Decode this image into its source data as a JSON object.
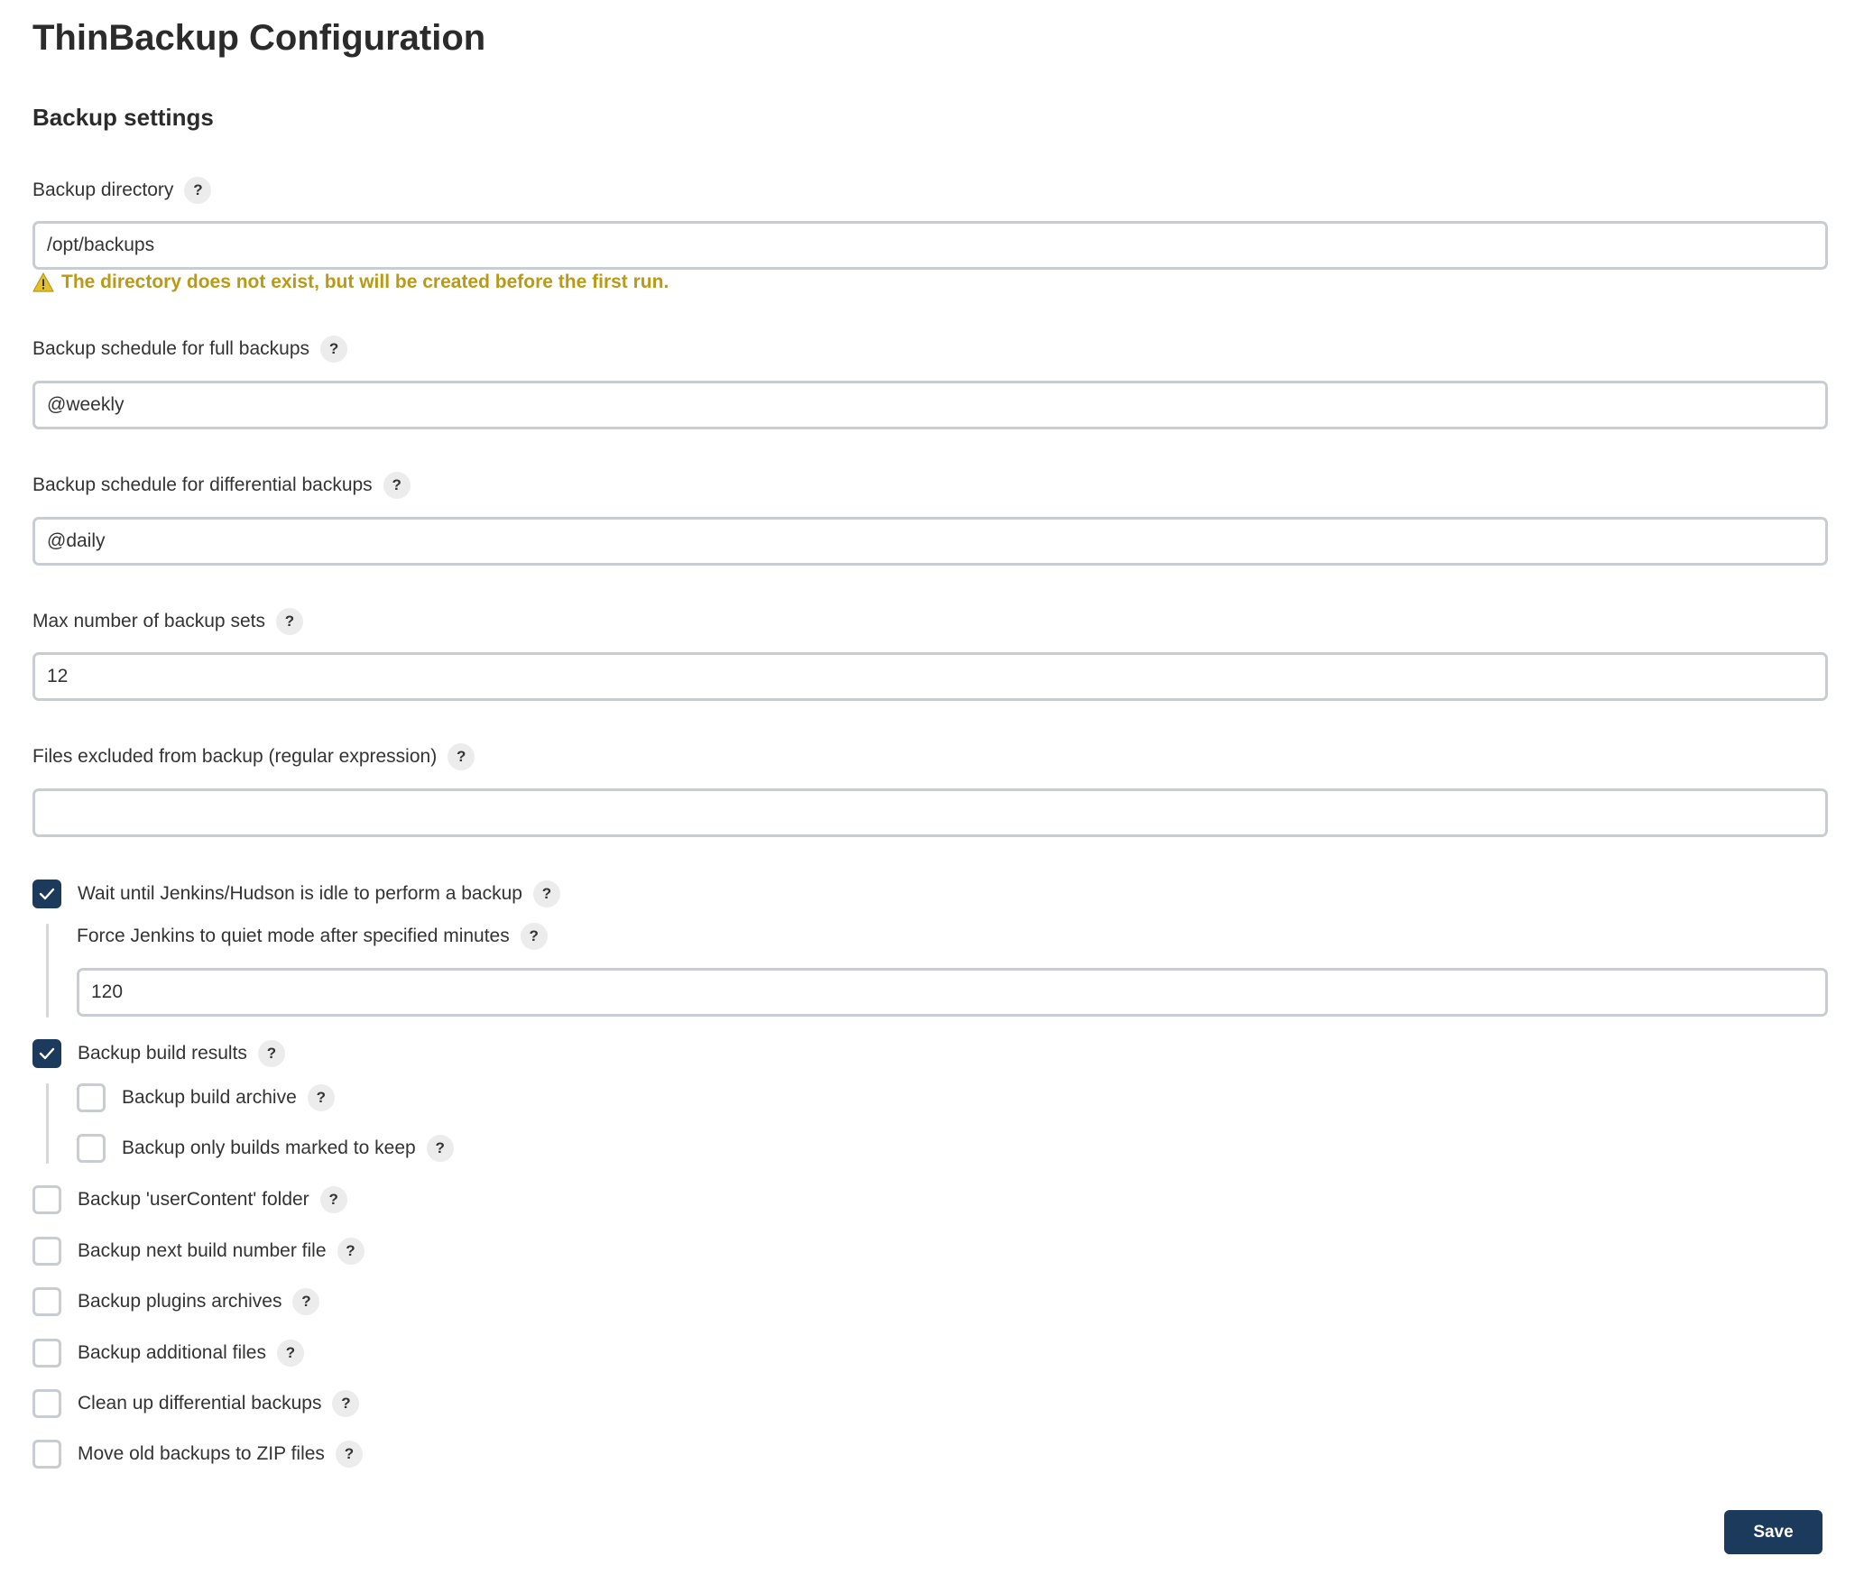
{
  "page": {
    "title": "ThinBackup Configuration",
    "section_title": "Backup settings"
  },
  "fields": {
    "backup_directory": {
      "label": "Backup directory",
      "value": "/opt/backups",
      "warning": "The directory does not exist, but will be created before the first run."
    },
    "full_schedule": {
      "label": "Backup schedule for full backups",
      "value": "@weekly"
    },
    "diff_schedule": {
      "label": "Backup schedule for differential backups",
      "value": "@daily"
    },
    "max_sets": {
      "label": "Max number of backup sets",
      "value": "12"
    },
    "excluded_files": {
      "label": "Files excluded from backup (regular expression)",
      "value": ""
    },
    "quiet_mode": {
      "label": "Force Jenkins to quiet mode after specified minutes",
      "value": "120"
    }
  },
  "options": {
    "wait_idle": {
      "label": "Wait until Jenkins/Hudson is idle to perform a backup",
      "checked": true
    },
    "build_results": {
      "label": "Backup build results",
      "checked": true
    },
    "build_archive": {
      "label": "Backup build archive",
      "checked": false
    },
    "builds_keep": {
      "label": "Backup only builds marked to keep",
      "checked": false
    },
    "user_content": {
      "label": "Backup 'userContent' folder",
      "checked": false
    },
    "next_build_number": {
      "label": "Backup next build number file",
      "checked": false
    },
    "plugins_archives": {
      "label": "Backup plugins archives",
      "checked": false
    },
    "additional_files": {
      "label": "Backup additional files",
      "checked": false
    },
    "cleanup_diff": {
      "label": "Clean up differential backups",
      "checked": false
    },
    "zip_old": {
      "label": "Move old backups to ZIP files",
      "checked": false
    }
  },
  "help_label": "?",
  "save_label": "Save",
  "colors": {
    "accent": "#1c3a5b",
    "warning": "#b99a16",
    "input_border": "#c9cdd2"
  }
}
